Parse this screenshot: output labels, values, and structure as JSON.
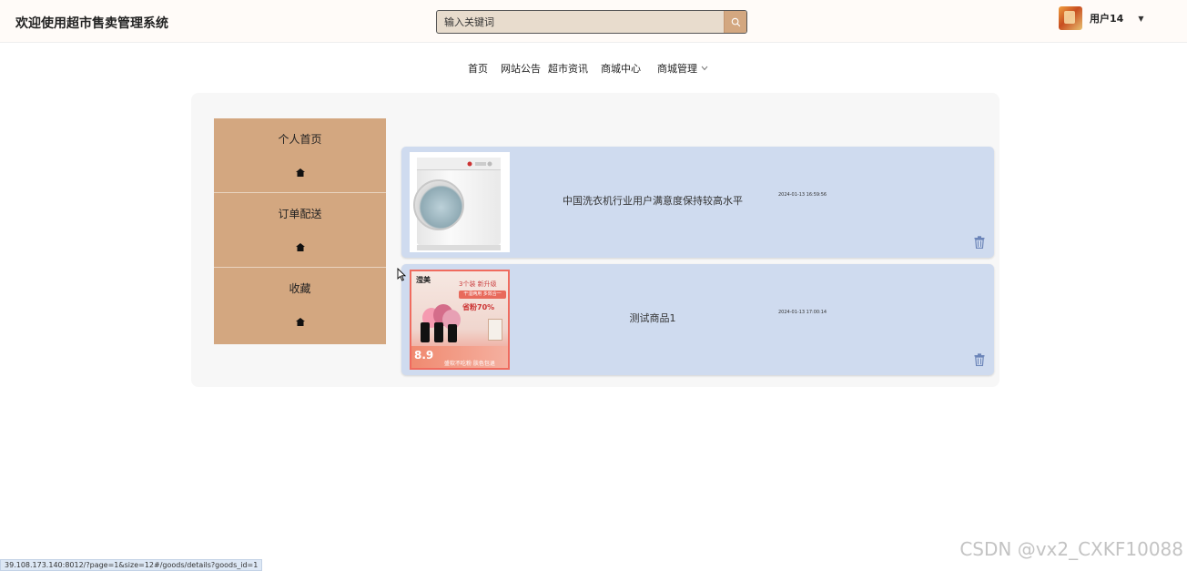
{
  "header": {
    "site_title": "欢迎使用超市售卖管理系统",
    "search_placeholder": "输入关键词",
    "user_name": "用户14"
  },
  "nav": {
    "items": [
      "首页",
      "网站公告",
      "超市资讯",
      "商城中心"
    ],
    "mall_manage": "商城管理"
  },
  "side_menu": {
    "items": [
      {
        "label": "个人首页",
        "icon": "home-icon"
      },
      {
        "label": "订单配送",
        "icon": "home-icon"
      },
      {
        "label": "收藏",
        "icon": "home-icon"
      }
    ]
  },
  "favorites": [
    {
      "title": "中国洗衣机行业用户满意度保持较高水平",
      "time": "2024-01-13 16:59:56",
      "image": "washing-machine"
    },
    {
      "title": "测试商品1",
      "time": "2024-01-13 17:00:14",
      "image": "sponge-ad"
    }
  ],
  "ad": {
    "brand": "滢美",
    "line1": "3个装 新升级",
    "tag": "干湿两用 多效合一",
    "save": "省粉70%",
    "price": "8.9",
    "bottom": "盛软不吃粉 肤色包退"
  },
  "status_url": "39.108.173.140:8012/?page=1&size=12#/goods/details?goods_id=1",
  "watermark": "CSDN @vx2_CXKF10088",
  "colors": {
    "menu_bg": "#d3a780",
    "card_bg": "#cfdbef",
    "search_bg": "#e8dccd",
    "trash": "#6b84b8"
  }
}
